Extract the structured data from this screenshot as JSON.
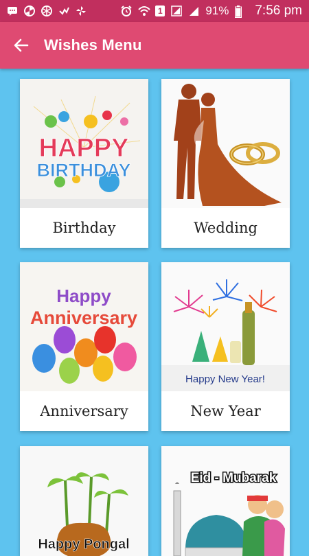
{
  "status_bar": {
    "battery_percent": "91%",
    "time": "7:56 pm",
    "sim_slot": "1",
    "icons": [
      "message-icon",
      "pinwheel-icon",
      "aperture-icon",
      "check-icon",
      "fan-icon",
      "alarm-icon",
      "wifi-icon",
      "sim-icon",
      "signal-icon",
      "battery-icon"
    ]
  },
  "app_bar": {
    "back_icon": "back-arrow-icon",
    "title": "Wishes Menu"
  },
  "colors": {
    "status_bar": "#c12f5e",
    "app_bar": "#df4a72",
    "background": "#5ec3ef",
    "card": "#ffffff"
  },
  "cards": [
    {
      "label": "Birthday",
      "image_text": [
        "HAPPY",
        "BIRTHDAY"
      ]
    },
    {
      "label": "Wedding",
      "image_text": []
    },
    {
      "label": "Anniversary",
      "image_text": [
        "Happy",
        "Anniversary"
      ]
    },
    {
      "label": "New Year",
      "image_text": [
        "Happy New Year!"
      ]
    },
    {
      "label": "",
      "image_text": [
        "Happy Pongal"
      ]
    },
    {
      "label": "",
      "image_text": [
        "Eid - Mubarak"
      ]
    }
  ]
}
